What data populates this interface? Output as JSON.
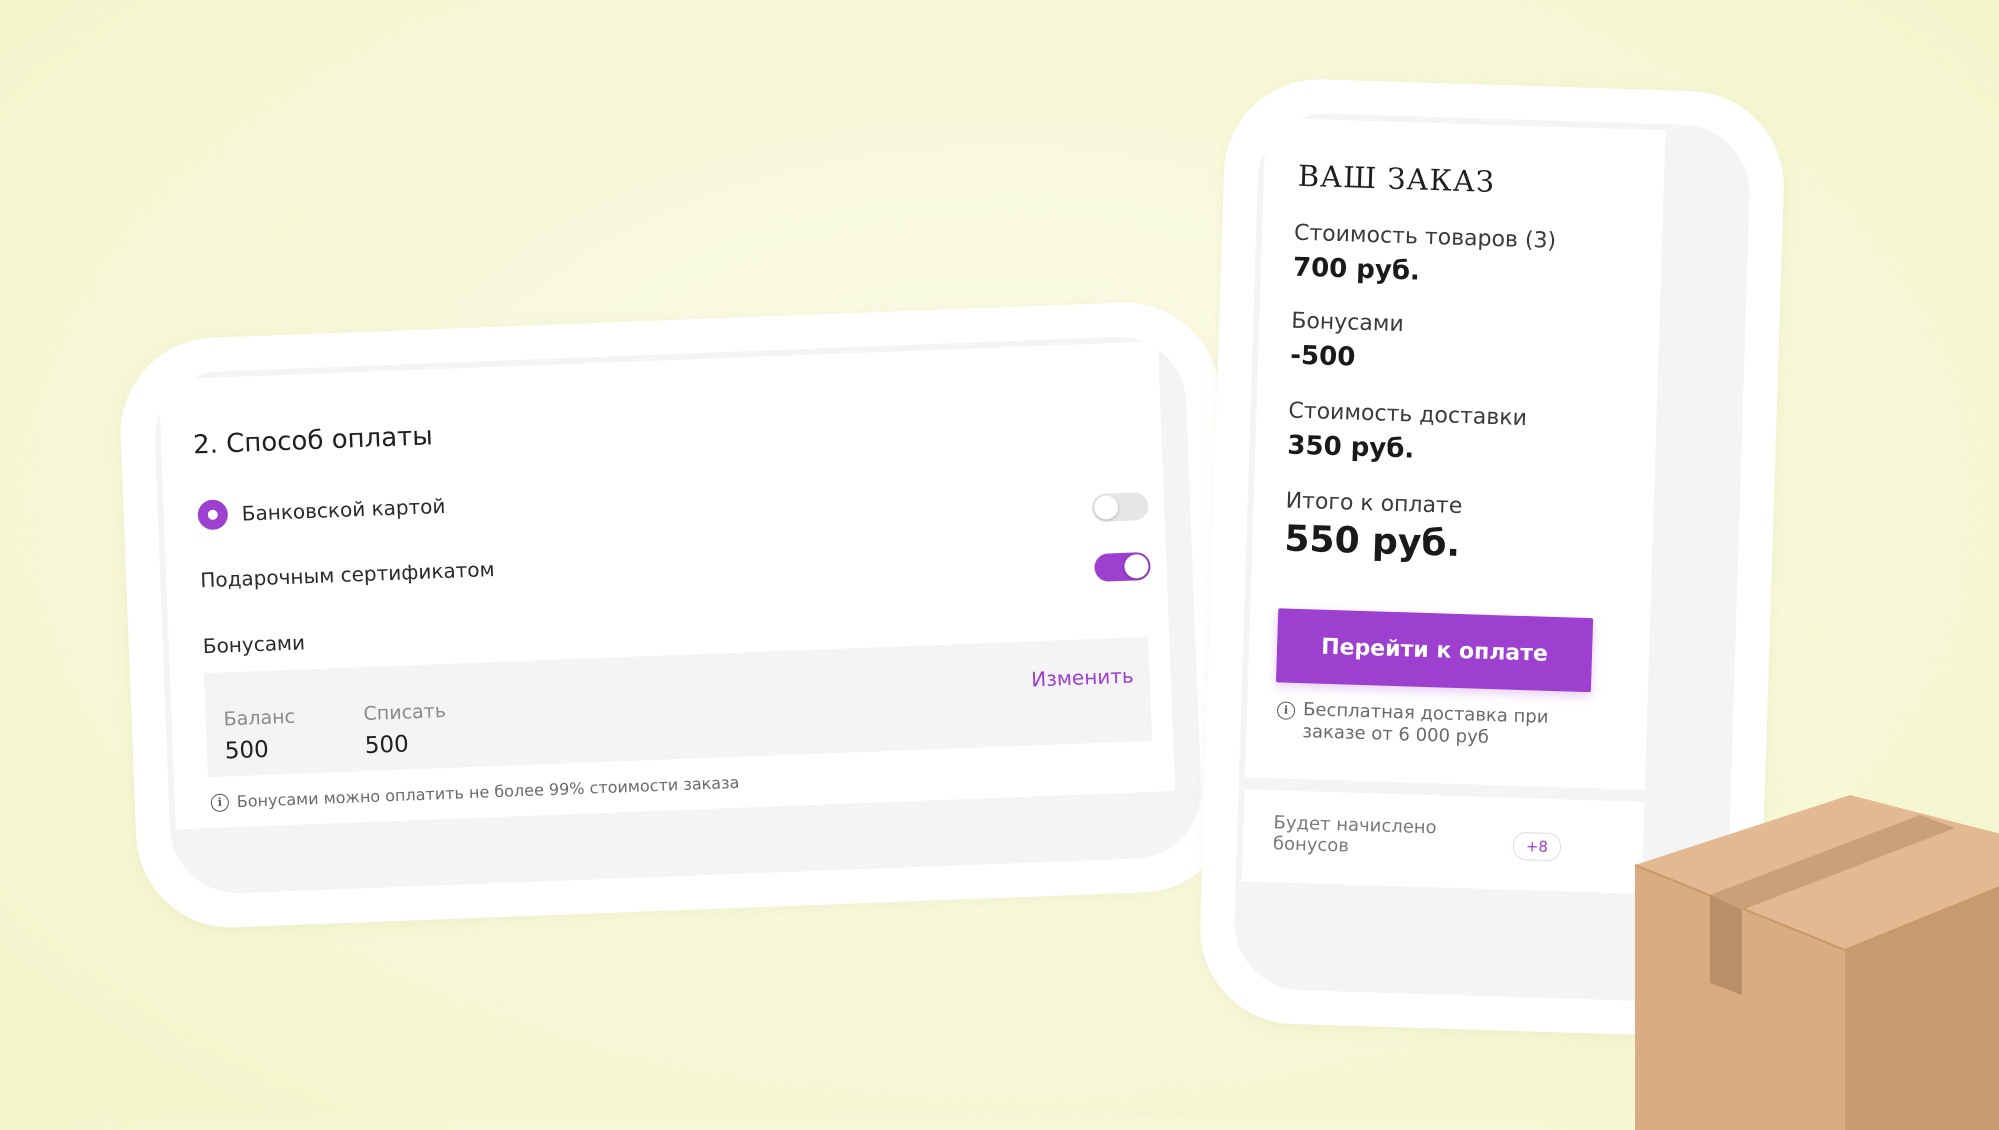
{
  "payment": {
    "title": "2. Способ оплаты",
    "card_option": "Банковской картой",
    "gift_option": "Подарочным сертификатом",
    "bonus_option": "Бонусами",
    "gift_toggle_on": false,
    "bonus_toggle_on": true,
    "bonus_box": {
      "balance_label": "Баланс",
      "balance_value": "500",
      "writeoff_label": "Списать",
      "writeoff_value": "500",
      "change_link": "Изменить"
    },
    "note": "Бонусами можно оплатить не более 99% стоимости заказа"
  },
  "order": {
    "title": "ВАШ ЗАКАЗ",
    "goods_label": "Стоимость товаров (3)",
    "goods_value": "700 руб.",
    "bonus_label": "Бонусами",
    "bonus_value": "-500",
    "delivery_label": "Стоимость доставки",
    "delivery_value": "350 руб.",
    "total_label": "Итого к оплате",
    "total_value": "550 руб.",
    "pay_button": "Перейти к оплате",
    "delivery_note_line1": "Бесплатная доставка при",
    "delivery_note_line2": "заказе от 6 000 руб",
    "bonus_accrual_line1": "Будет начислено",
    "bonus_accrual_line2": "бонусов",
    "bonus_accrual_badge": "+8"
  },
  "colors": {
    "accent": "#9d3fcf",
    "background": "#f7f8d8"
  }
}
